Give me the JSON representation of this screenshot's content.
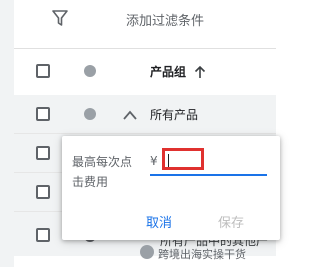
{
  "filter_bar": {
    "icon": "filter-icon",
    "label": "添加过滤条件"
  },
  "table": {
    "header": {
      "column_label": "产品组",
      "sort_icon": "arrow-up-icon"
    },
    "all_products_row": {
      "label": "所有产品",
      "expand_icon": "chevron-up-icon"
    },
    "partial_row_label": "所有产品中的其他产"
  },
  "bid_popup": {
    "field_label": "最高每次点击费用",
    "currency_symbol": "¥",
    "value": "",
    "cancel_label": "取消",
    "save_label": "保存"
  },
  "watermark": {
    "text": "跨境出海实操干货"
  },
  "colors": {
    "accent": "#1a73e8",
    "highlight_box": "#e0312f"
  }
}
